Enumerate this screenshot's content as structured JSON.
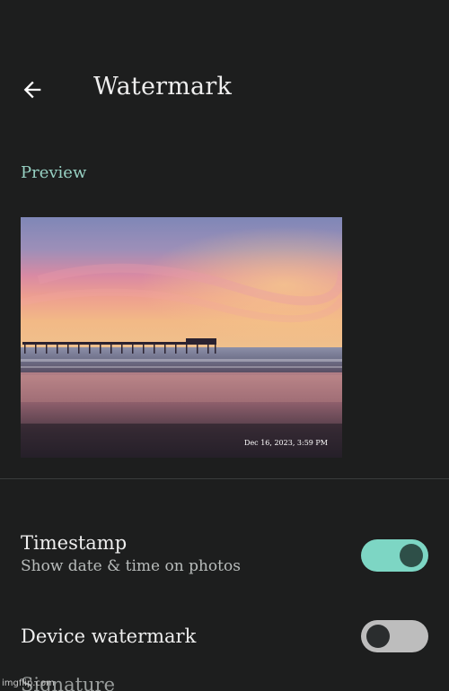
{
  "header": {
    "title": "Watermark",
    "back_icon": "arrow-left-icon"
  },
  "preview": {
    "section_label": "Preview",
    "stamp_text": "Dec 16, 2023, 3:59 PM"
  },
  "settings": {
    "timestamp": {
      "title": "Timestamp",
      "subtitle": "Show date & time on photos",
      "enabled": true
    },
    "device_watermark": {
      "title": "Device watermark",
      "enabled": false
    },
    "signature": {
      "title": "Signature"
    }
  },
  "footer_credit": "imgflip.com",
  "colors": {
    "background": "#1d1e1e",
    "accent": "#98d2c4",
    "switch_on_track": "#7dd6c4",
    "switch_off_track": "#bdbdbd"
  }
}
